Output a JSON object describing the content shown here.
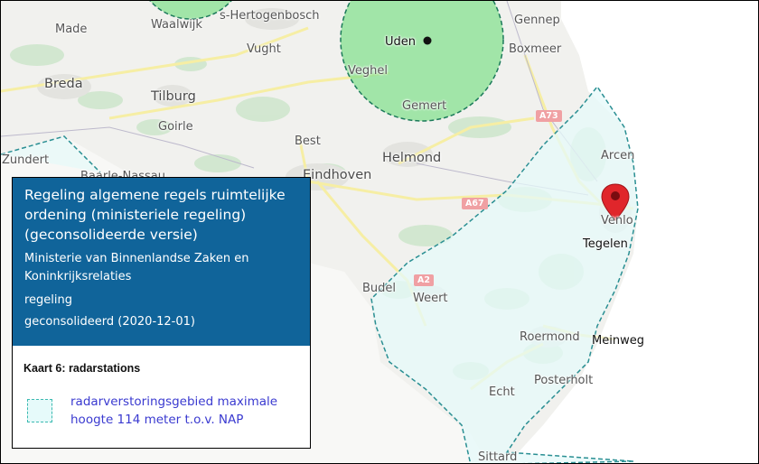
{
  "places": {
    "made": "Made",
    "waalwijk": "Waalwijk",
    "s_hertogenbosch": "s-Hertogenbosch",
    "gennep": "Gennep",
    "uden": "Uden",
    "boxmeer": "Boxmeer",
    "vught": "Vught",
    "veghel": "Veghel",
    "breda": "Breda",
    "tilburg": "Tilburg",
    "gemert": "Gemert",
    "goirle": "Goirle",
    "best": "Best",
    "helmond": "Helmond",
    "arcen": "Arcen",
    "zundert": "Zundert",
    "baarle_nassau": "Baarle-Nassau",
    "eindhoven": "Eindhoven",
    "venlo": "Venlo",
    "tegelen": "Tegelen",
    "budel": "Budel",
    "weert": "Weert",
    "roermond": "Roermond",
    "meinweg": "Meinweg",
    "posterholt": "Posterholt",
    "echt": "Echt",
    "sittard": "Sittard"
  },
  "roads": {
    "a73": "A73",
    "a67": "A67",
    "a2": "A2"
  },
  "panel": {
    "title": "Regeling algemene regels ruimtelijke ordening (ministeriele regeling) (geconsolideerde versie)",
    "ministry": "Ministerie van Binnenlandse Zaken en Koninkrijksrelaties",
    "type": "regeling",
    "status": "geconsolideerd (2020-12-01)"
  },
  "legend": {
    "heading": "Kaart 6: radarstations",
    "item_label": "radarverstoringsgebied maximale hoogte 114 meter t.o.v. NAP",
    "swatch_fill": "#e6fafa",
    "swatch_border": "#3cbab1"
  },
  "colors": {
    "panel_header": "#10649a",
    "radar_circle": "#7fe08a",
    "marker": "#e0262b"
  },
  "icons": {
    "marker": "map-pin-icon",
    "radar_station": "radar-station-dot-icon"
  }
}
